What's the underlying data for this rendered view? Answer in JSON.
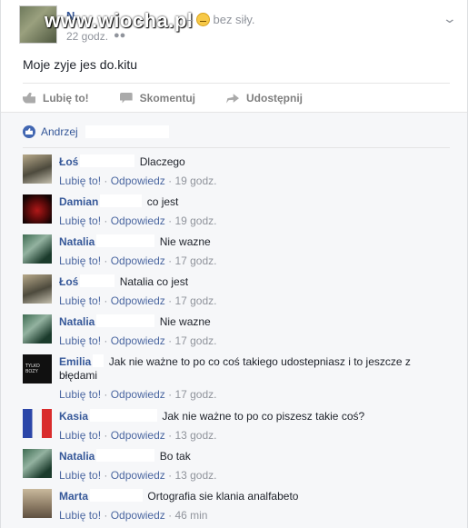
{
  "watermark": "www.wiocha.pl",
  "post": {
    "author": "N...",
    "time": "22 godz.",
    "audience_icon": "friends-icon",
    "feeling_prefix": "–",
    "feeling": "bez siły.",
    "text": "Moje zyje jes do.kitu",
    "actions": {
      "like": "Lubię to!",
      "comment": "Skomentuj",
      "share": "Udostępnij"
    }
  },
  "likes": {
    "name": "Andrzej"
  },
  "comment_meta": {
    "like": "Lubię to!",
    "sep": " · ",
    "reply": "Odpowiedz"
  },
  "comments": [
    {
      "name": "Łoś",
      "text": "Dlaczego",
      "time": "19 godz."
    },
    {
      "name": "Damian",
      "text": "co jest",
      "time": "19 godz."
    },
    {
      "name": "Natalia",
      "text": "Nie wazne",
      "time": "17 godz."
    },
    {
      "name": "Łoś",
      "text": "Natalia co jest",
      "time": "17 godz."
    },
    {
      "name": "Natalia",
      "text": "Nie wazne",
      "time": "17 godz."
    },
    {
      "name": "Emilia",
      "text": "Jak nie ważne to po co coś takiego udostepniasz i to jeszcze z błędami",
      "time": "17 godz."
    },
    {
      "name": "Kasia",
      "text": "Jak nie ważne to po co piszesz takie coś?",
      "time": "13 godz."
    },
    {
      "name": "Natalia",
      "text": "Bo tak",
      "time": "13 godz."
    },
    {
      "name": "Marta",
      "text": "Ortografia sie klania analfabeto",
      "time": "46 min"
    }
  ],
  "colors": {
    "link": "#365899",
    "meta": "#90949c",
    "comments_bg": "#f6f7f9",
    "like_badge": "#4267b2"
  }
}
